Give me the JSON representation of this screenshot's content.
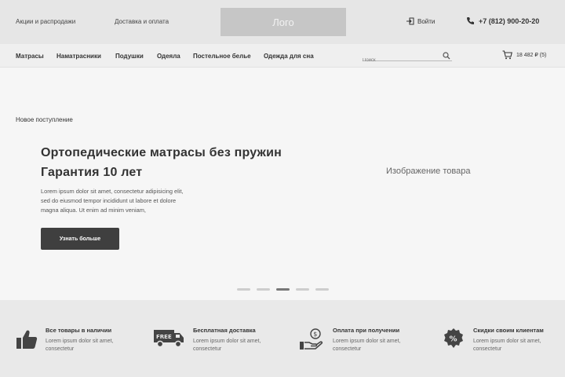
{
  "header": {
    "links": [
      "Акции и распродажи",
      "Доставка и оплата"
    ],
    "logo": "Лого",
    "login": "Войти",
    "phone": "+7 (812) 900-20-20"
  },
  "nav": {
    "items": [
      "Матрасы",
      "Наматрасники",
      "Подушки",
      "Одеяла",
      "Постельное белье",
      "Одежда для сна"
    ],
    "search_placeholder": "Поиск",
    "cart": "18 482 ₽  (5)"
  },
  "hero": {
    "eyebrow": "Новое поступление",
    "title_line1": "Ортопедические матрасы без пружин",
    "title_line2": "Гарантия 10 лет",
    "text_line1": "Lorem ipsum dolor sit amet, consectetur adipisicing elit,",
    "text_line2": "sed do eiusmod tempor incididunt ut labore et dolore",
    "text_line3": "magna aliqua. Ut enim ad minim veniam,",
    "cta": "Узнать больше",
    "product_image": "Изображение товара",
    "slides_count": 5,
    "active_slide": 3
  },
  "features": [
    {
      "icon": "thumbs-up-icon",
      "title": "Все товары в наличии",
      "text": "Lorem ipsum dolor sit amet, consectetur"
    },
    {
      "icon": "truck-icon",
      "title": "Бесплатная доставка",
      "text": "Lorem ipsum dolor sit amet, consectetur",
      "badge": "FREE"
    },
    {
      "icon": "coin-hand-icon",
      "title": "Оплата при получении",
      "text": "Lorem ipsum dolor sit amet, consectetur",
      "badge": "$"
    },
    {
      "icon": "percent-badge-icon",
      "title": "Скидки своим клиентам",
      "text": "Lorem ipsum dolor sit amet, consectetur",
      "badge": "%"
    }
  ]
}
